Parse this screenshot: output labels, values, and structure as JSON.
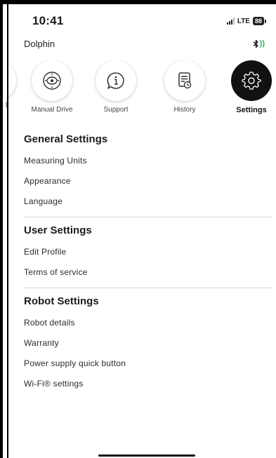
{
  "status_bar": {
    "time": "10:41",
    "network": "LTE",
    "battery": "88"
  },
  "device": {
    "name": "Dolphin",
    "connection_icon": "bluetooth-icon",
    "connection_color": "#21b35c"
  },
  "tabs": [
    {
      "label": "l",
      "icon": "partial-tab"
    },
    {
      "label": "Manual Drive",
      "icon": "joystick-icon"
    },
    {
      "label": "Support",
      "icon": "info-chat-icon"
    },
    {
      "label": "History",
      "icon": "history-document-icon"
    },
    {
      "label": "Settings",
      "icon": "gear-icon",
      "active": true
    }
  ],
  "sections": [
    {
      "title": "General Settings",
      "items": [
        "Measuring Units",
        "Appearance",
        "Language"
      ]
    },
    {
      "title": "User Settings",
      "items": [
        "Edit Profile",
        "Terms of service"
      ]
    },
    {
      "title": "Robot Settings",
      "items": [
        "Robot details",
        "Warranty",
        "Power supply quick button",
        "Wi-Fi® settings"
      ]
    }
  ],
  "colors": {
    "active_tab": "#111111",
    "divider": "#d4d4d4"
  }
}
